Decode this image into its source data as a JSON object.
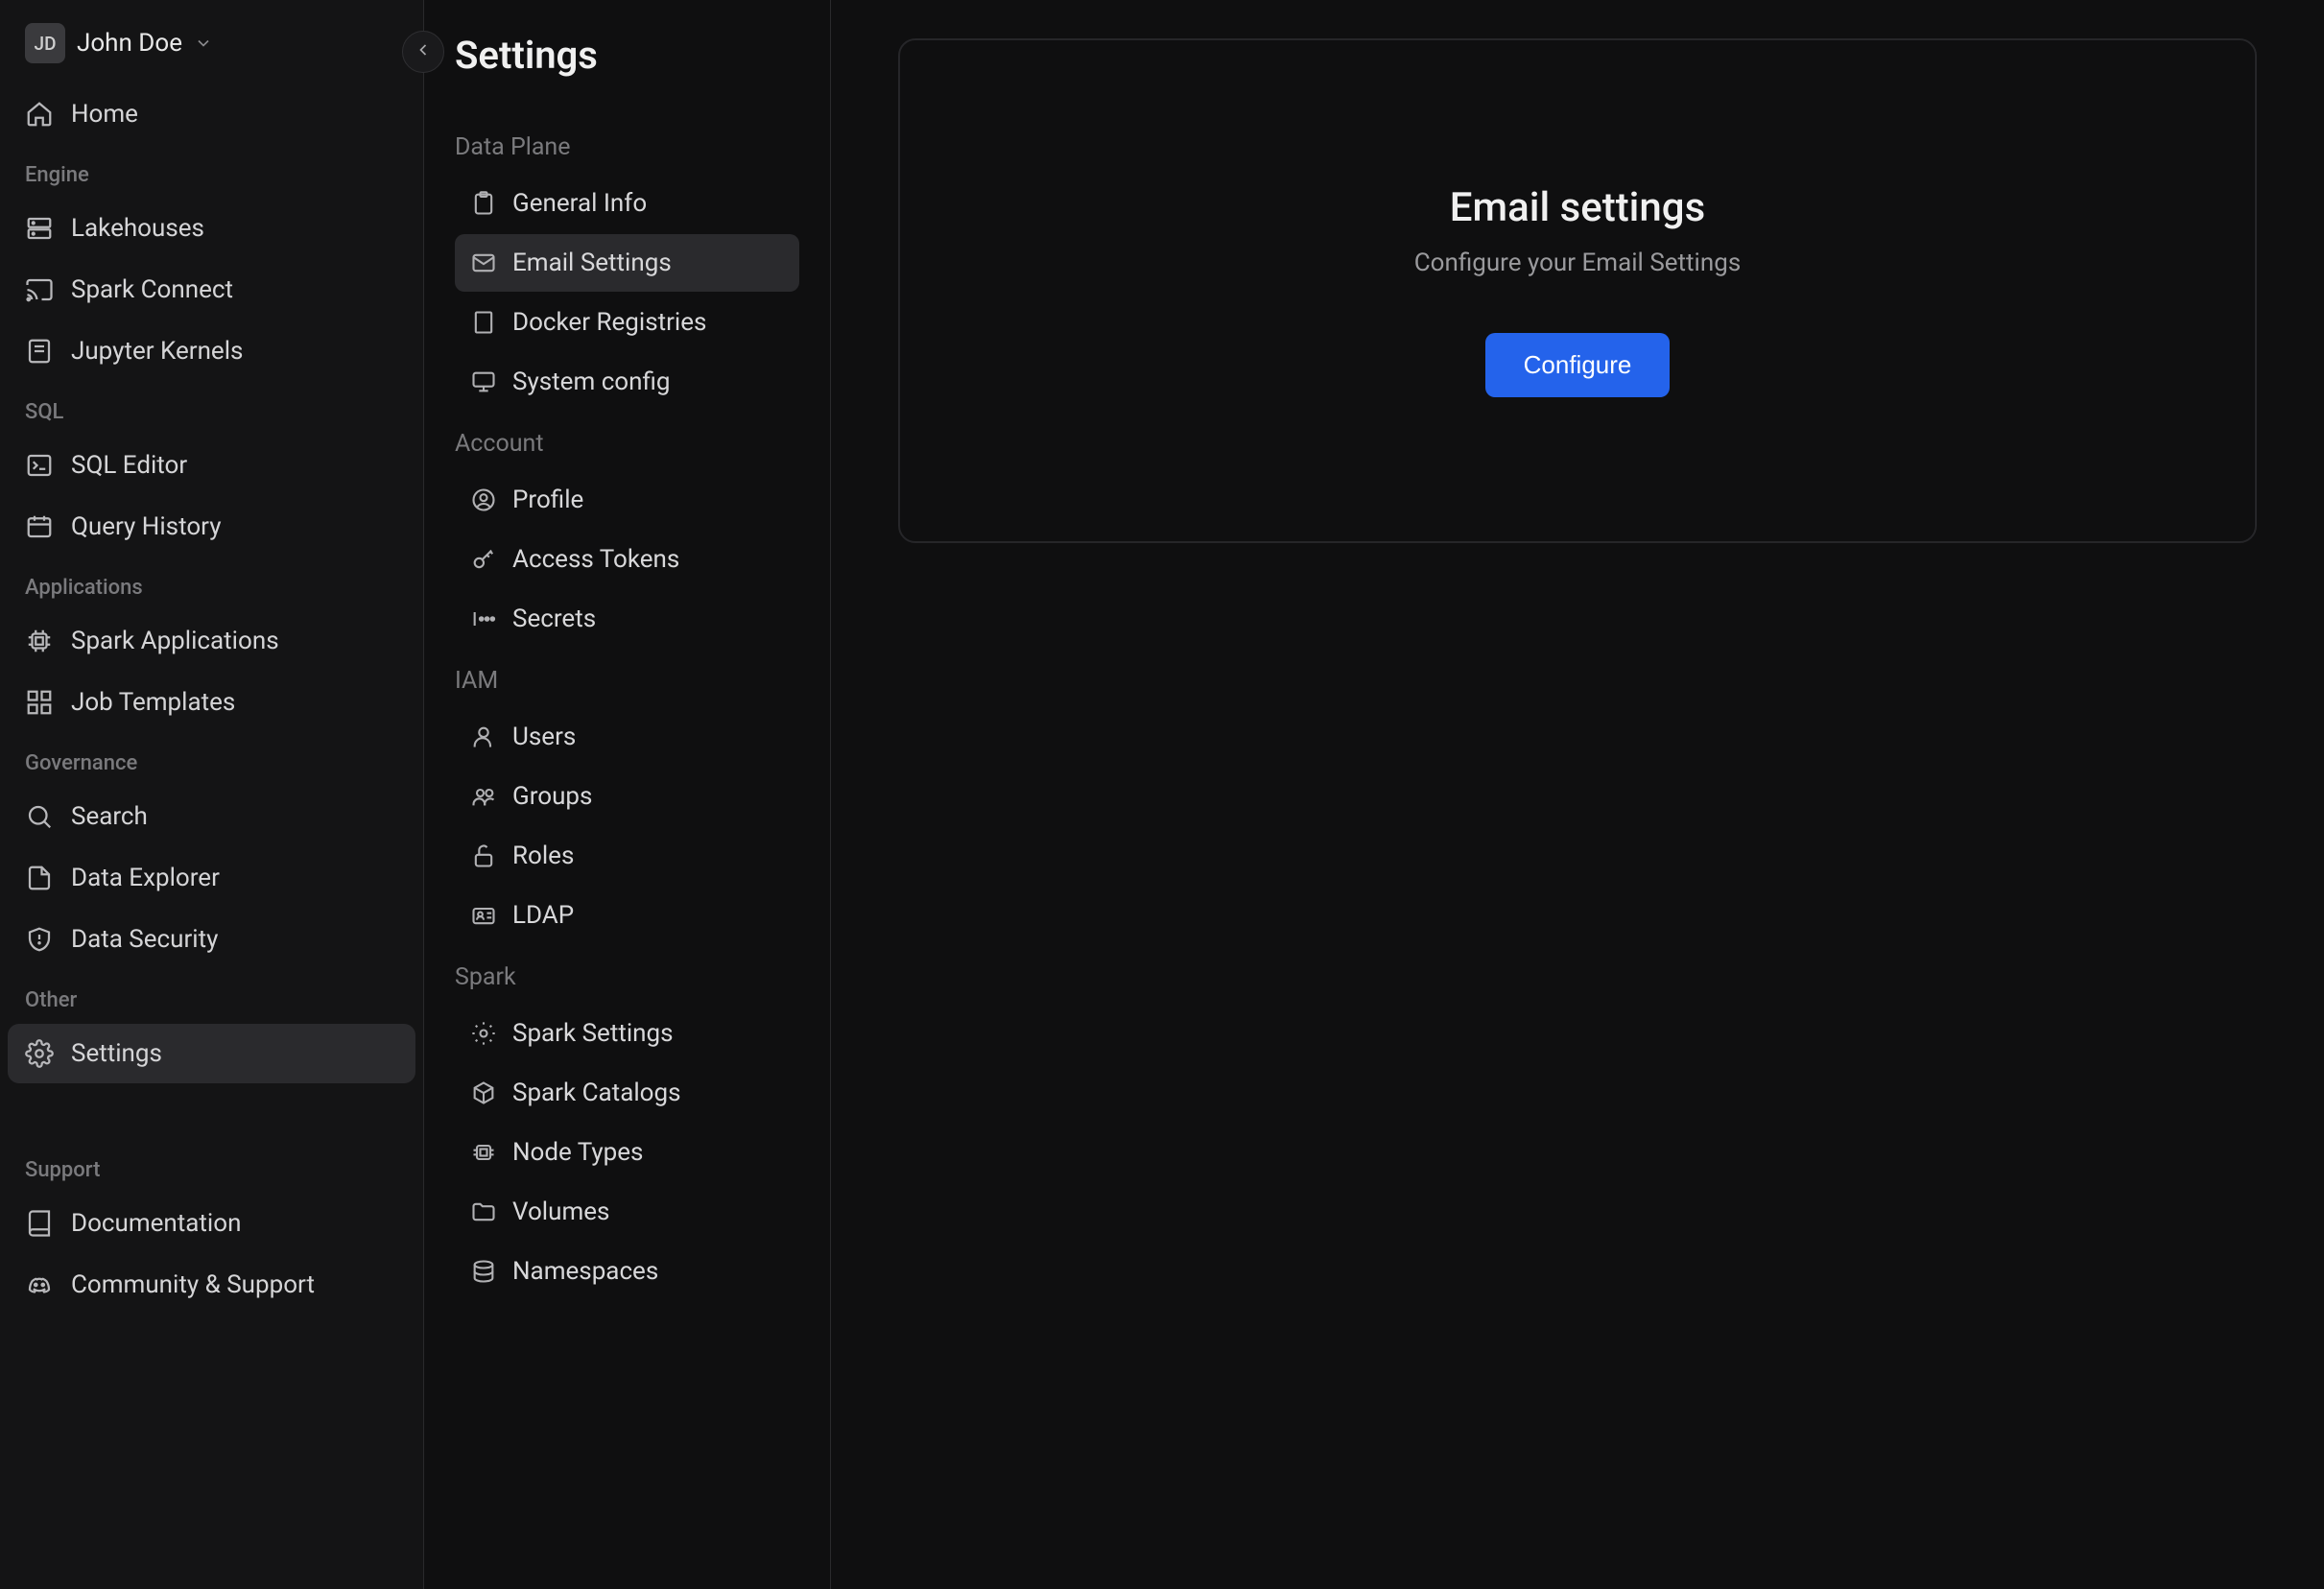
{
  "user": {
    "initials": "JD",
    "name": "John Doe"
  },
  "nav": {
    "home": "Home",
    "sections": {
      "engine": {
        "label": "Engine",
        "items": {
          "lakehouses": "Lakehouses",
          "spark_connect": "Spark Connect",
          "jupyter_kernels": "Jupyter Kernels"
        }
      },
      "sql": {
        "label": "SQL",
        "items": {
          "sql_editor": "SQL Editor",
          "query_history": "Query History"
        }
      },
      "applications": {
        "label": "Applications",
        "items": {
          "spark_applications": "Spark Applications",
          "job_templates": "Job Templates"
        }
      },
      "governance": {
        "label": "Governance",
        "items": {
          "search": "Search",
          "data_explorer": "Data Explorer",
          "data_security": "Data Security"
        }
      },
      "other": {
        "label": "Other",
        "items": {
          "settings": "Settings"
        }
      },
      "support": {
        "label": "Support",
        "items": {
          "documentation": "Documentation",
          "community_support": "Community & Support"
        }
      }
    }
  },
  "settings_panel": {
    "title": "Settings",
    "groups": {
      "data_plane": {
        "label": "Data Plane",
        "items": {
          "general_info": "General Info",
          "email_settings": "Email Settings",
          "docker_registries": "Docker Registries",
          "system_config": "System config"
        }
      },
      "account": {
        "label": "Account",
        "items": {
          "profile": "Profile",
          "access_tokens": "Access Tokens",
          "secrets": "Secrets"
        }
      },
      "iam": {
        "label": "IAM",
        "items": {
          "users": "Users",
          "groups": "Groups",
          "roles": "Roles",
          "ldap": "LDAP"
        }
      },
      "spark": {
        "label": "Spark",
        "items": {
          "spark_settings": "Spark Settings",
          "spark_catalogs": "Spark Catalogs",
          "node_types": "Node Types",
          "volumes": "Volumes",
          "namespaces": "Namespaces"
        }
      }
    }
  },
  "main": {
    "title": "Email settings",
    "subtitle": "Configure your Email Settings",
    "button": "Configure"
  }
}
